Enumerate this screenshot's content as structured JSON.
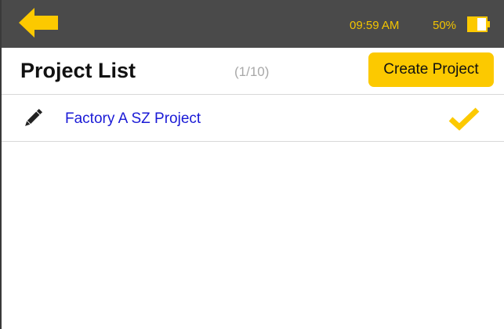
{
  "status_bar": {
    "time": "09:59 AM",
    "battery_percent": "50%",
    "back_icon": "arrow-left-icon",
    "battery_icon": "battery-icon",
    "accent_color": "#f2c400",
    "background_color": "#4a4a4a"
  },
  "header": {
    "title": "Project List",
    "count": "(1/10)",
    "create_button_label": "Create Project",
    "button_color": "#fcc900"
  },
  "projects": [
    {
      "name": "Factory A SZ Project",
      "selected": true,
      "edit_icon": "pencil-icon",
      "check_icon": "checkmark-icon",
      "name_color": "#1a1ad6"
    }
  ]
}
